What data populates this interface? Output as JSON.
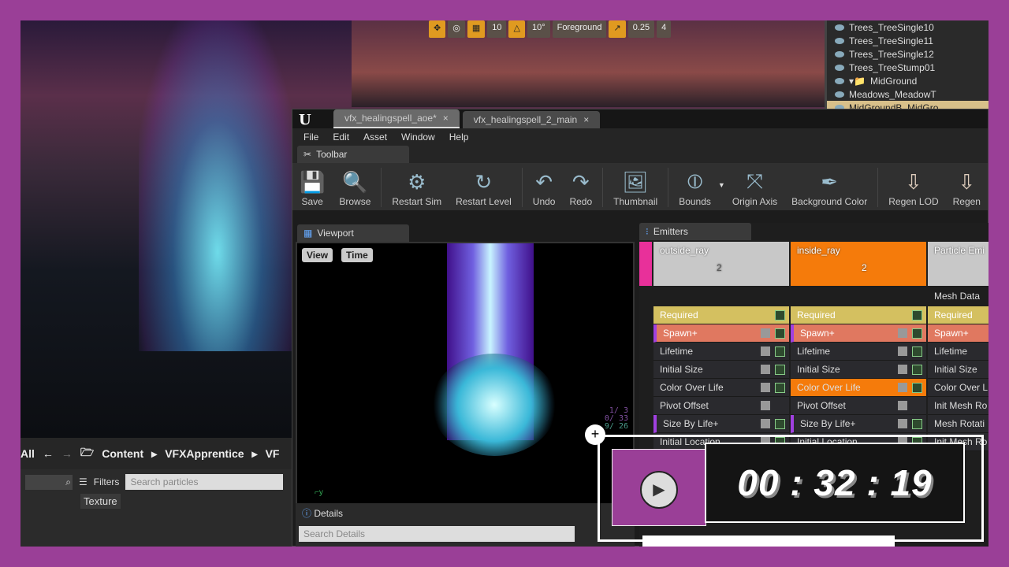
{
  "level_toolbar": {
    "grid": "10",
    "rotation": "10°",
    "layer": "Foreground",
    "scale": "0.25",
    "camera_speed": "4"
  },
  "outliner": {
    "items": [
      "Trees_TreeSingle10",
      "Trees_TreeSingle11",
      "Trees_TreeSingle12",
      "Trees_TreeStump01",
      "MidGround",
      "Meadows_MeadowT",
      "MidGroundB_MidGro"
    ]
  },
  "content_browser": {
    "all": "All",
    "path": [
      "Content",
      "VFXApprentice",
      "VF"
    ],
    "filters": "Filters",
    "search_placeholder": "Search particles",
    "filter_chip": "Texture"
  },
  "cascade": {
    "tabs": [
      "vfx_healingspell_aoe*",
      "vfx_healingspell_2_main"
    ],
    "menu": [
      "File",
      "Edit",
      "Asset",
      "Window",
      "Help"
    ],
    "toolbar_tab": "Toolbar",
    "toolbar": [
      "Save",
      "Browse",
      "Restart Sim",
      "Restart Level",
      "Undo",
      "Redo",
      "Thumbnail",
      "Bounds",
      "Origin Axis",
      "Background Color",
      "Regen LOD",
      "Regen"
    ],
    "viewport": {
      "tab": "Viewport",
      "view": "View",
      "time": "Time",
      "stats": [
        "1/ 3",
        "0/ 33",
        "9/ 26"
      ]
    },
    "details": {
      "tab": "Details",
      "search_placeholder": "Search Details"
    },
    "emitters": {
      "tab": "Emitters",
      "columns": [
        {
          "name": "outside_ray",
          "count": "2",
          "modules": [
            "Required",
            "Spawn+",
            "Lifetime",
            "Initial Size",
            "Color Over Life",
            "Pivot Offset",
            "Size By Life+",
            "Initial Location"
          ]
        },
        {
          "name": "inside_ray",
          "count": "2",
          "modules": [
            "Required",
            "Spawn+",
            "Lifetime",
            "Initial Size",
            "Color Over Life",
            "Pivot Offset",
            "Size By Life+",
            "Initial Location"
          ]
        },
        {
          "name": "Particle Emi",
          "header2": "Mesh Data",
          "modules": [
            "Required",
            "Spawn+",
            "Lifetime",
            "Initial Size",
            "Color Over L",
            "Init Mesh Ro",
            "Mesh Rotati",
            "Init Mesh Ro"
          ]
        }
      ]
    }
  },
  "timer": {
    "time": "00 : 32 : 19"
  },
  "colors": {
    "frame": "#9a3f97",
    "required": "#d4c060",
    "spawn": "#e07860",
    "selected": "#f57b0b"
  }
}
